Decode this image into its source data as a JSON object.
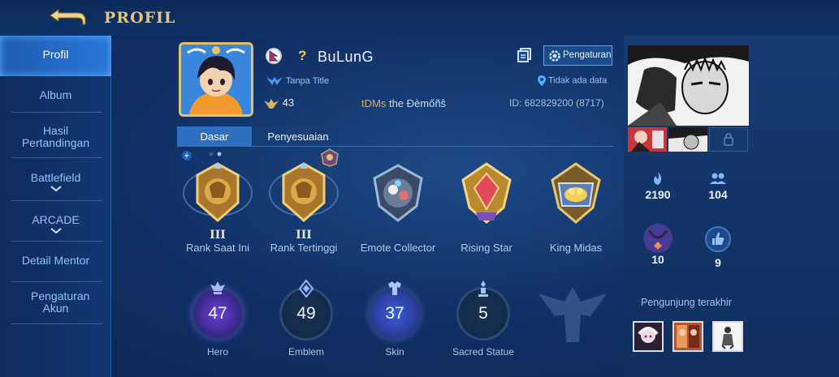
{
  "header": {
    "title": "PROFIL",
    "back_icon": "back-arrow-icon"
  },
  "sidebar": {
    "items": [
      {
        "label": "Profil",
        "active": true
      },
      {
        "label": "Album"
      },
      {
        "label": "Hasil Pertandingan"
      },
      {
        "label": "Battlefield",
        "expandable": true
      },
      {
        "label": "ARCADE",
        "expandable": true
      },
      {
        "label": "Detail Mentor"
      },
      {
        "label": "Pengaturan Akun"
      }
    ]
  },
  "profile": {
    "name": "BuLunG",
    "unknown_mark": "?",
    "title": "Tanpa Title",
    "level": "43",
    "squad_tag": "tDMs",
    "squad_name": "the Ðèmőñŝ",
    "location": "Tidak ada data",
    "id": "ID: 682829200 (8717)",
    "settings_label": "Pengaturan"
  },
  "tabs": [
    {
      "label": "Dasar",
      "active": true
    },
    {
      "label": "Penyesuaian"
    }
  ],
  "badges": [
    {
      "tier": "III",
      "label": "Rank Saat Ini"
    },
    {
      "tier": "III",
      "label": "Rank Tertinggi"
    },
    {
      "tier": "",
      "label": "Emote Collector"
    },
    {
      "tier": "",
      "label": "Rising Star"
    },
    {
      "tier": "",
      "label": "King Midas"
    }
  ],
  "counters": [
    {
      "value": "47",
      "label": "Hero",
      "color": "#7b5cff"
    },
    {
      "value": "49",
      "label": "Emblem",
      "color": "#4f8fd6"
    },
    {
      "value": "37",
      "label": "Skin",
      "color": "#4d74e8"
    },
    {
      "value": "5",
      "label": "Sacred Statue",
      "color": "#5b8fd0"
    }
  ],
  "stats": {
    "popularity": "2190",
    "friends": "104",
    "charm": "10",
    "likes": "9"
  },
  "visitors": {
    "title": "Pengunjung terakhir"
  },
  "colors": {
    "gold": "#e6c57a",
    "accent": "#2e6fc0",
    "bg": "#11336a"
  }
}
